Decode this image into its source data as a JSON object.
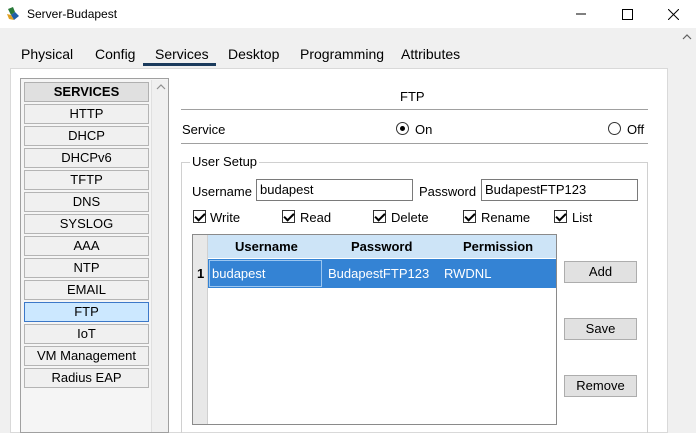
{
  "window": {
    "title": "Server-Budapest"
  },
  "tabs": [
    {
      "label": "Physical"
    },
    {
      "label": "Config"
    },
    {
      "label": "Services"
    },
    {
      "label": "Desktop"
    },
    {
      "label": "Programming"
    },
    {
      "label": "Attributes"
    }
  ],
  "active_tab": "Services",
  "services": {
    "header": "SERVICES",
    "items": [
      "HTTP",
      "DHCP",
      "DHCPv6",
      "TFTP",
      "DNS",
      "SYSLOG",
      "AAA",
      "NTP",
      "EMAIL",
      "FTP",
      "IoT",
      "VM Management",
      "Radius EAP"
    ],
    "selected": "FTP"
  },
  "ftp": {
    "title": "FTP",
    "service_label": "Service",
    "on_label": "On",
    "off_label": "Off",
    "service_state": "On",
    "user_setup_title": "User Setup",
    "username_label": "Username",
    "username_value": "budapest",
    "password_label": "Password",
    "password_value": "BudapestFTP123",
    "permissions": {
      "write": {
        "label": "Write",
        "checked": true
      },
      "read": {
        "label": "Read",
        "checked": true
      },
      "delete": {
        "label": "Delete",
        "checked": true
      },
      "rename": {
        "label": "Rename",
        "checked": true
      },
      "list": {
        "label": "List",
        "checked": true
      }
    },
    "table": {
      "columns": [
        "Username",
        "Password",
        "Permission"
      ],
      "rows": [
        {
          "num": "1",
          "username": "budapest",
          "password": "BudapestFTP123",
          "permission": "RWDNL"
        }
      ]
    },
    "buttons": {
      "add": "Add",
      "save": "Save",
      "remove": "Remove"
    }
  },
  "colors": {
    "selected_row": "#3483d4",
    "table_header": "#cde4f7",
    "active_service": "#cce8ff"
  }
}
